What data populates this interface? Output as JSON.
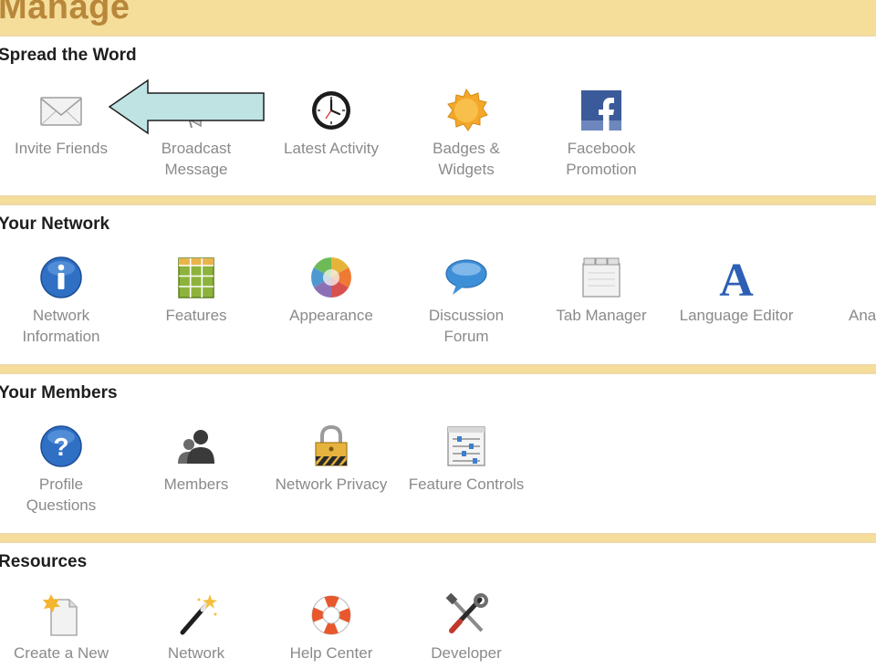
{
  "page_title": "Manage",
  "sections": [
    {
      "heading": "Spread the Word",
      "items": [
        {
          "label": "Invite Friends",
          "icon": "envelope-icon"
        },
        {
          "label": "Broadcast\nMessage",
          "icon": "megaphone-icon"
        },
        {
          "label": "Latest Activity",
          "icon": "clock-icon"
        },
        {
          "label": "Badges &\nWidgets",
          "icon": "badge-icon"
        },
        {
          "label": "Facebook\nPromotion",
          "icon": "facebook-icon"
        }
      ]
    },
    {
      "heading": "Your Network",
      "items": [
        {
          "label": "Network\nInformation",
          "icon": "info-icon"
        },
        {
          "label": "Features",
          "icon": "grid-icon"
        },
        {
          "label": "Appearance",
          "icon": "color-wheel-icon"
        },
        {
          "label": "Discussion\nForum",
          "icon": "speech-bubble-icon"
        },
        {
          "label": "Tab Manager",
          "icon": "tabs-icon"
        },
        {
          "label": "Language Editor",
          "icon": "letter-a-icon"
        },
        {
          "label": "Analy",
          "icon": "bar-chart-icon"
        }
      ]
    },
    {
      "heading": "Your Members",
      "items": [
        {
          "label": "Profile\nQuestions",
          "icon": "question-icon"
        },
        {
          "label": "Members",
          "icon": "people-icon"
        },
        {
          "label": "Network Privacy",
          "icon": "padlock-icon"
        },
        {
          "label": "Feature Controls",
          "icon": "sliders-icon"
        }
      ]
    },
    {
      "heading": "Resources",
      "items": [
        {
          "label": "Create a New",
          "icon": "new-page-icon"
        },
        {
          "label": "Network",
          "icon": "magic-wand-icon"
        },
        {
          "label": "Help Center",
          "icon": "lifebuoy-icon"
        },
        {
          "label": "Developer",
          "icon": "tools-icon"
        }
      ]
    }
  ],
  "colors": {
    "page_background": "#f5dd9a",
    "title": "#b8873a",
    "label": "#8a8a8a",
    "arrow_fill": "#bfe3e3"
  }
}
